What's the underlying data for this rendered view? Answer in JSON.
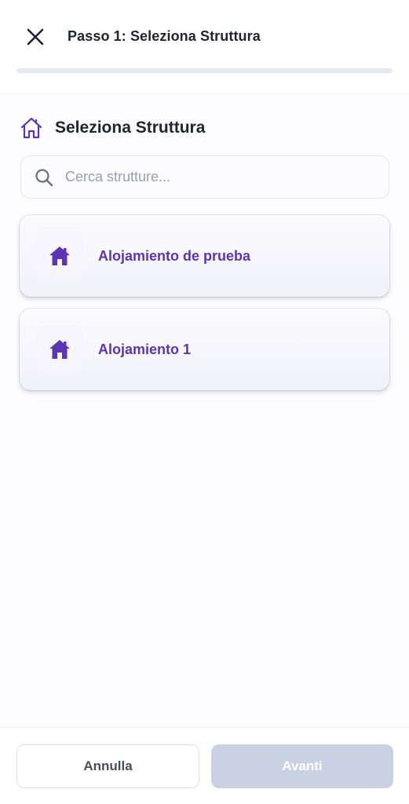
{
  "header": {
    "title": "Passo 1: Seleziona Struttura",
    "close_icon": "close-icon"
  },
  "progress": {
    "step": 1
  },
  "section": {
    "title": "Seleziona Struttura",
    "icon": "home-outline-icon"
  },
  "search": {
    "placeholder": "Cerca strutture...",
    "value": "",
    "icon": "search-icon"
  },
  "properties": [
    {
      "label": "Alojamiento de prueba",
      "icon": "home-icon"
    },
    {
      "label": "Alojamiento 1",
      "icon": "home-icon"
    }
  ],
  "footer": {
    "cancel_label": "Annulla",
    "next_label": "Avanti"
  },
  "colors": {
    "accent": "#5b35b2",
    "disabled_button": "#c8d2e2",
    "text_primary": "#222430",
    "placeholder": "#9a9ead"
  }
}
